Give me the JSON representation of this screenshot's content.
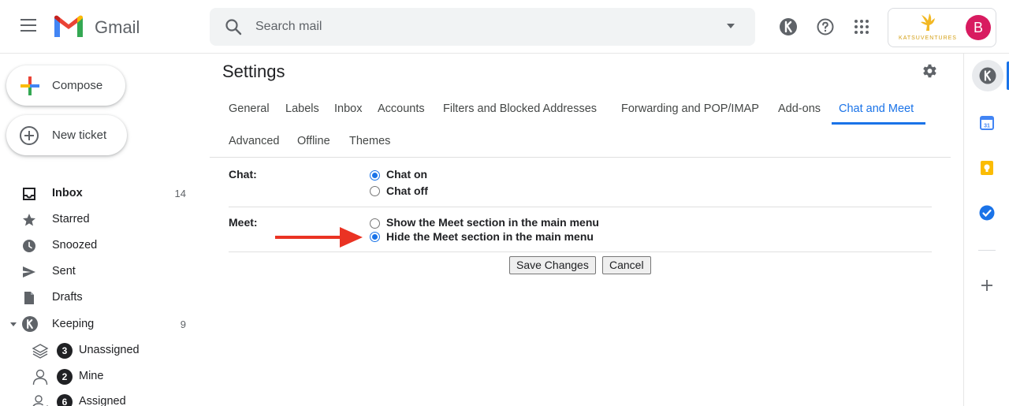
{
  "app": {
    "name": "Gmail"
  },
  "search": {
    "placeholder": "Search mail"
  },
  "account": {
    "brand": "KATSUVENTURES",
    "avatar_letter": "B",
    "avatar_color": "#d81b60"
  },
  "sidebar": {
    "compose_label": "Compose",
    "new_ticket_label": "New ticket",
    "items": [
      {
        "label": "Inbox",
        "count": "14",
        "icon": "inbox-icon",
        "bold": true
      },
      {
        "label": "Starred",
        "count": "",
        "icon": "star-icon"
      },
      {
        "label": "Snoozed",
        "count": "",
        "icon": "clock-icon"
      },
      {
        "label": "Sent",
        "count": "",
        "icon": "send-icon"
      },
      {
        "label": "Drafts",
        "count": "",
        "icon": "draft-icon"
      },
      {
        "label": "Keeping",
        "count": "9",
        "icon": "keeping-icon"
      }
    ],
    "sub_items": [
      {
        "label": "Unassigned",
        "badge": "3",
        "icon": "layers-icon"
      },
      {
        "label": "Mine",
        "badge": "2",
        "icon": "person-icon"
      },
      {
        "label": "Assigned",
        "badge": "6",
        "icon": "people-icon"
      }
    ]
  },
  "settings": {
    "title": "Settings",
    "tabs": [
      {
        "label": "General"
      },
      {
        "label": "Labels"
      },
      {
        "label": "Inbox"
      },
      {
        "label": "Accounts"
      },
      {
        "label": "Filters and Blocked Addresses"
      },
      {
        "label": "Forwarding and POP/IMAP"
      },
      {
        "label": "Add-ons"
      },
      {
        "label": "Chat and Meet",
        "active": true
      },
      {
        "label": "Advanced"
      },
      {
        "label": "Offline"
      },
      {
        "label": "Themes"
      }
    ],
    "chat": {
      "label": "Chat:",
      "options": [
        {
          "label": "Chat on",
          "selected": true
        },
        {
          "label": "Chat off",
          "selected": false
        }
      ]
    },
    "meet": {
      "label": "Meet:",
      "options": [
        {
          "label": "Show the Meet section in the main menu",
          "selected": false
        },
        {
          "label": "Hide the Meet section in the main menu",
          "selected": true
        }
      ]
    },
    "save_label": "Save Changes",
    "cancel_label": "Cancel"
  },
  "colors": {
    "accent": "#1a73e8",
    "arrow": "#ea3323"
  }
}
